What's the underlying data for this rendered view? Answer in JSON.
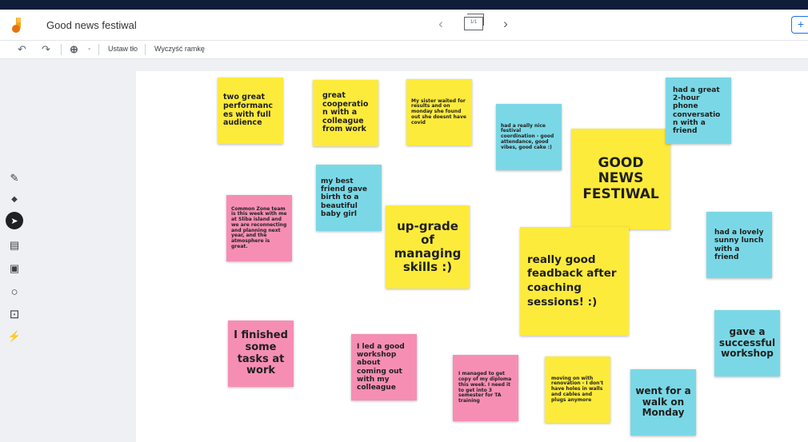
{
  "app": {
    "title": "Good news festiwal",
    "frame_counter": "1/1",
    "nav_prev": "‹",
    "nav_next": "›",
    "present_icon": "+"
  },
  "toolbar": {
    "undo": "↶",
    "redo": "↷",
    "zoom": "⊕",
    "zoom_minus": "-",
    "set_background": "Ustaw tło",
    "clear_frame": "Wyczyść ramkę"
  },
  "tools": {
    "pen": "✎",
    "eraser": "◆",
    "select": "➤",
    "sticky": "▤",
    "image": "▣",
    "shape": "○",
    "text": "⊡",
    "laser": "⚡"
  },
  "colors": {
    "yellow": "#fdeb3b",
    "blue": "#7ad8e6",
    "pink": "#f68eb4"
  },
  "notes": [
    {
      "text": "two great performances with full audience",
      "color": "yellow"
    },
    {
      "text": "great cooperation with a colleague from work",
      "color": "yellow"
    },
    {
      "text": "My sister waited for results and on monday she found out she doesnt have covid",
      "color": "yellow"
    },
    {
      "text": "had a really nice festival coordination - good attendance, good vibes, good cake :)",
      "color": "blue"
    },
    {
      "text": "GOOD NEWS FESTIWAL",
      "color": "yellow"
    },
    {
      "text": "had a great 2-hour phone conversation with a friend",
      "color": "blue"
    },
    {
      "text": "my best friend gave birth to a beautiful baby girl",
      "color": "blue"
    },
    {
      "text": "Common Zone team is this week with me at Sliba island and we are reconnecting and planning next year, and the atmosphere is great.",
      "color": "pink"
    },
    {
      "text": "up-grade of managing skills :)",
      "color": "yellow"
    },
    {
      "text": "really good feadback after coaching sessions! :)",
      "color": "yellow"
    },
    {
      "text": "had a lovely sunny lunch with a friend",
      "color": "blue"
    },
    {
      "text": "I finished some tasks at work",
      "color": "pink"
    },
    {
      "text": "I led a good workshop about coming out with my colleague",
      "color": "pink"
    },
    {
      "text": "I managed to get copy of my diploma this week. I need it to get into 3 semester for TA training",
      "color": "pink"
    },
    {
      "text": "moving on with renovation - I don't have holes in walls and cables and plugs anymore",
      "color": "yellow"
    },
    {
      "text": "went for a walk on Monday",
      "color": "blue"
    },
    {
      "text": "gave a successful workshop",
      "color": "blue"
    }
  ]
}
